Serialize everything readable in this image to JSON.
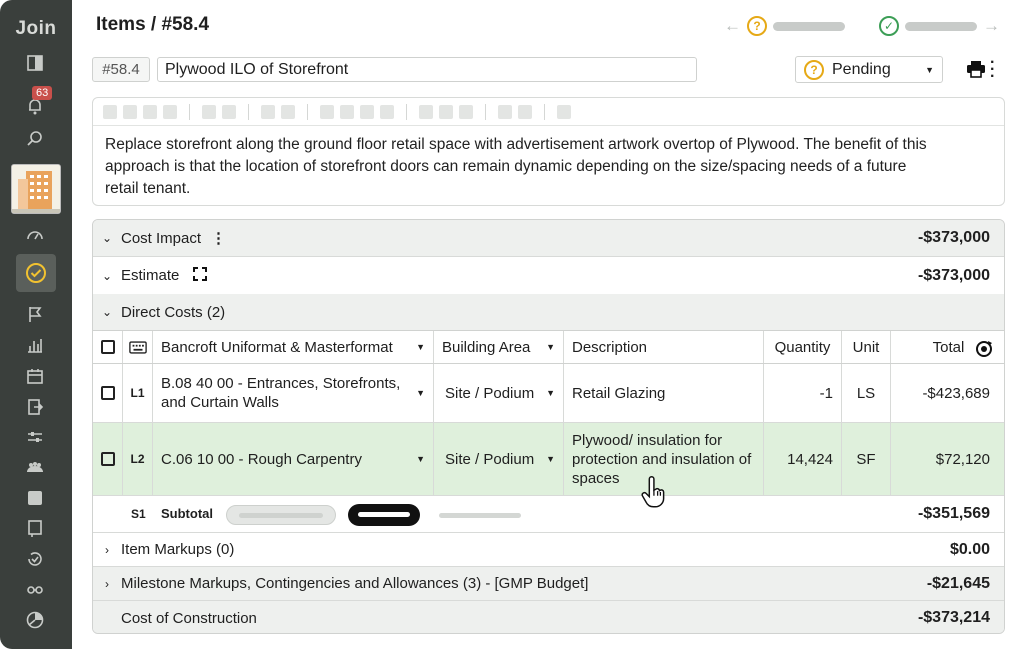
{
  "sidebar": {
    "logo": "Join",
    "notification_count": "63",
    "icons": [
      "sidebar-toggle-icon",
      "bell-icon",
      "search-icon",
      "project-thumbnail",
      "speedometer-icon",
      "check-circle-icon",
      "flag-icon",
      "chart-icon",
      "calendar-icon",
      "import-icon",
      "settings-sliders-icon",
      "team-icon",
      "square-icon",
      "book-icon",
      "history-icon",
      "glasses-icon",
      "pie-chart-icon"
    ]
  },
  "header": {
    "title": "Items / #58.4",
    "item_number": "#58.4",
    "item_name": "Plywood ILO of Storefront",
    "status": "Pending"
  },
  "description": {
    "text": "Replace storefront along the ground floor retail space with advertisement artwork overtop of Plywood. The benefit of this approach is that the location of storefront doors can remain dynamic depending on the size/spacing needs of a future retail tenant."
  },
  "cost": {
    "cost_impact": {
      "label": "Cost Impact",
      "value": "-$373,000"
    },
    "estimate": {
      "label": "Estimate",
      "value": "-$373,000"
    },
    "direct_costs": {
      "label": "Direct Costs (2)"
    },
    "columns": {
      "category": "Bancroft Uniformat & Masterformat",
      "area": "Building Area",
      "description": "Description",
      "quantity": "Quantity",
      "unit": "Unit",
      "total": "Total"
    },
    "lines": [
      {
        "level": "L1",
        "category": "B.08 40 00 - Entrances, Storefronts, and Curtain Walls",
        "area": "Site / Podium",
        "description": "Retail Glazing",
        "quantity": "-1",
        "unit": "LS",
        "total": "-$423,689"
      },
      {
        "level": "L2",
        "category": "C.06 10 00 - Rough Carpentry",
        "area": "Site / Podium",
        "description": "Plywood/ insulation for protection and insulation of spaces",
        "quantity": "14,424",
        "unit": "SF",
        "total": "$72,120"
      }
    ],
    "subtotal": {
      "level": "S1",
      "label": "Subtotal",
      "value": "-$351,569"
    },
    "item_markups": {
      "label": "Item Markups (0)",
      "value": "$0.00"
    },
    "milestone_markups": {
      "label": "Milestone Markups, Contingencies and Allowances (3) - [GMP Budget]",
      "value": "-$21,645"
    },
    "cost_of_construction": {
      "label": "Cost of Construction",
      "value": "-$373,214"
    }
  }
}
